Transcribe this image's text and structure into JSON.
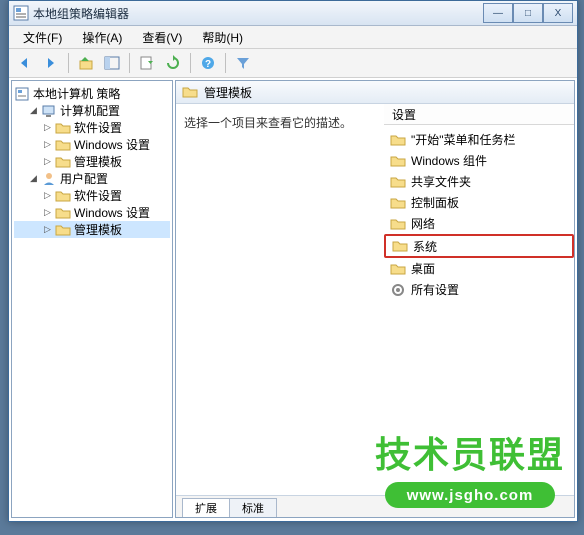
{
  "window": {
    "title": "本地组策略编辑器",
    "buttons": {
      "min": "—",
      "max": "□",
      "close": "X"
    }
  },
  "menu": {
    "file": "文件(F)",
    "action": "操作(A)",
    "view": "查看(V)",
    "help": "帮助(H)"
  },
  "tree": {
    "root": "本地计算机 策略",
    "comp": "计算机配置",
    "comp_sw": "软件设置",
    "comp_win": "Windows 设置",
    "comp_admin": "管理模板",
    "user": "用户配置",
    "user_sw": "软件设置",
    "user_win": "Windows 设置",
    "user_admin": "管理模板"
  },
  "header": {
    "title": "管理模板"
  },
  "desc": "选择一个项目来查看它的描述。",
  "list": {
    "col": "设置",
    "items": {
      "start": "\"开始\"菜单和任务栏",
      "wincomp": "Windows 组件",
      "shared": "共享文件夹",
      "control": "控制面板",
      "network": "网络",
      "system": "系统",
      "desktop": "桌面",
      "all": "所有设置"
    }
  },
  "tabs": {
    "ext": "扩展",
    "std": "标准"
  },
  "watermark": {
    "text": "技术员联盟",
    "url": "www.jsgho.com"
  }
}
